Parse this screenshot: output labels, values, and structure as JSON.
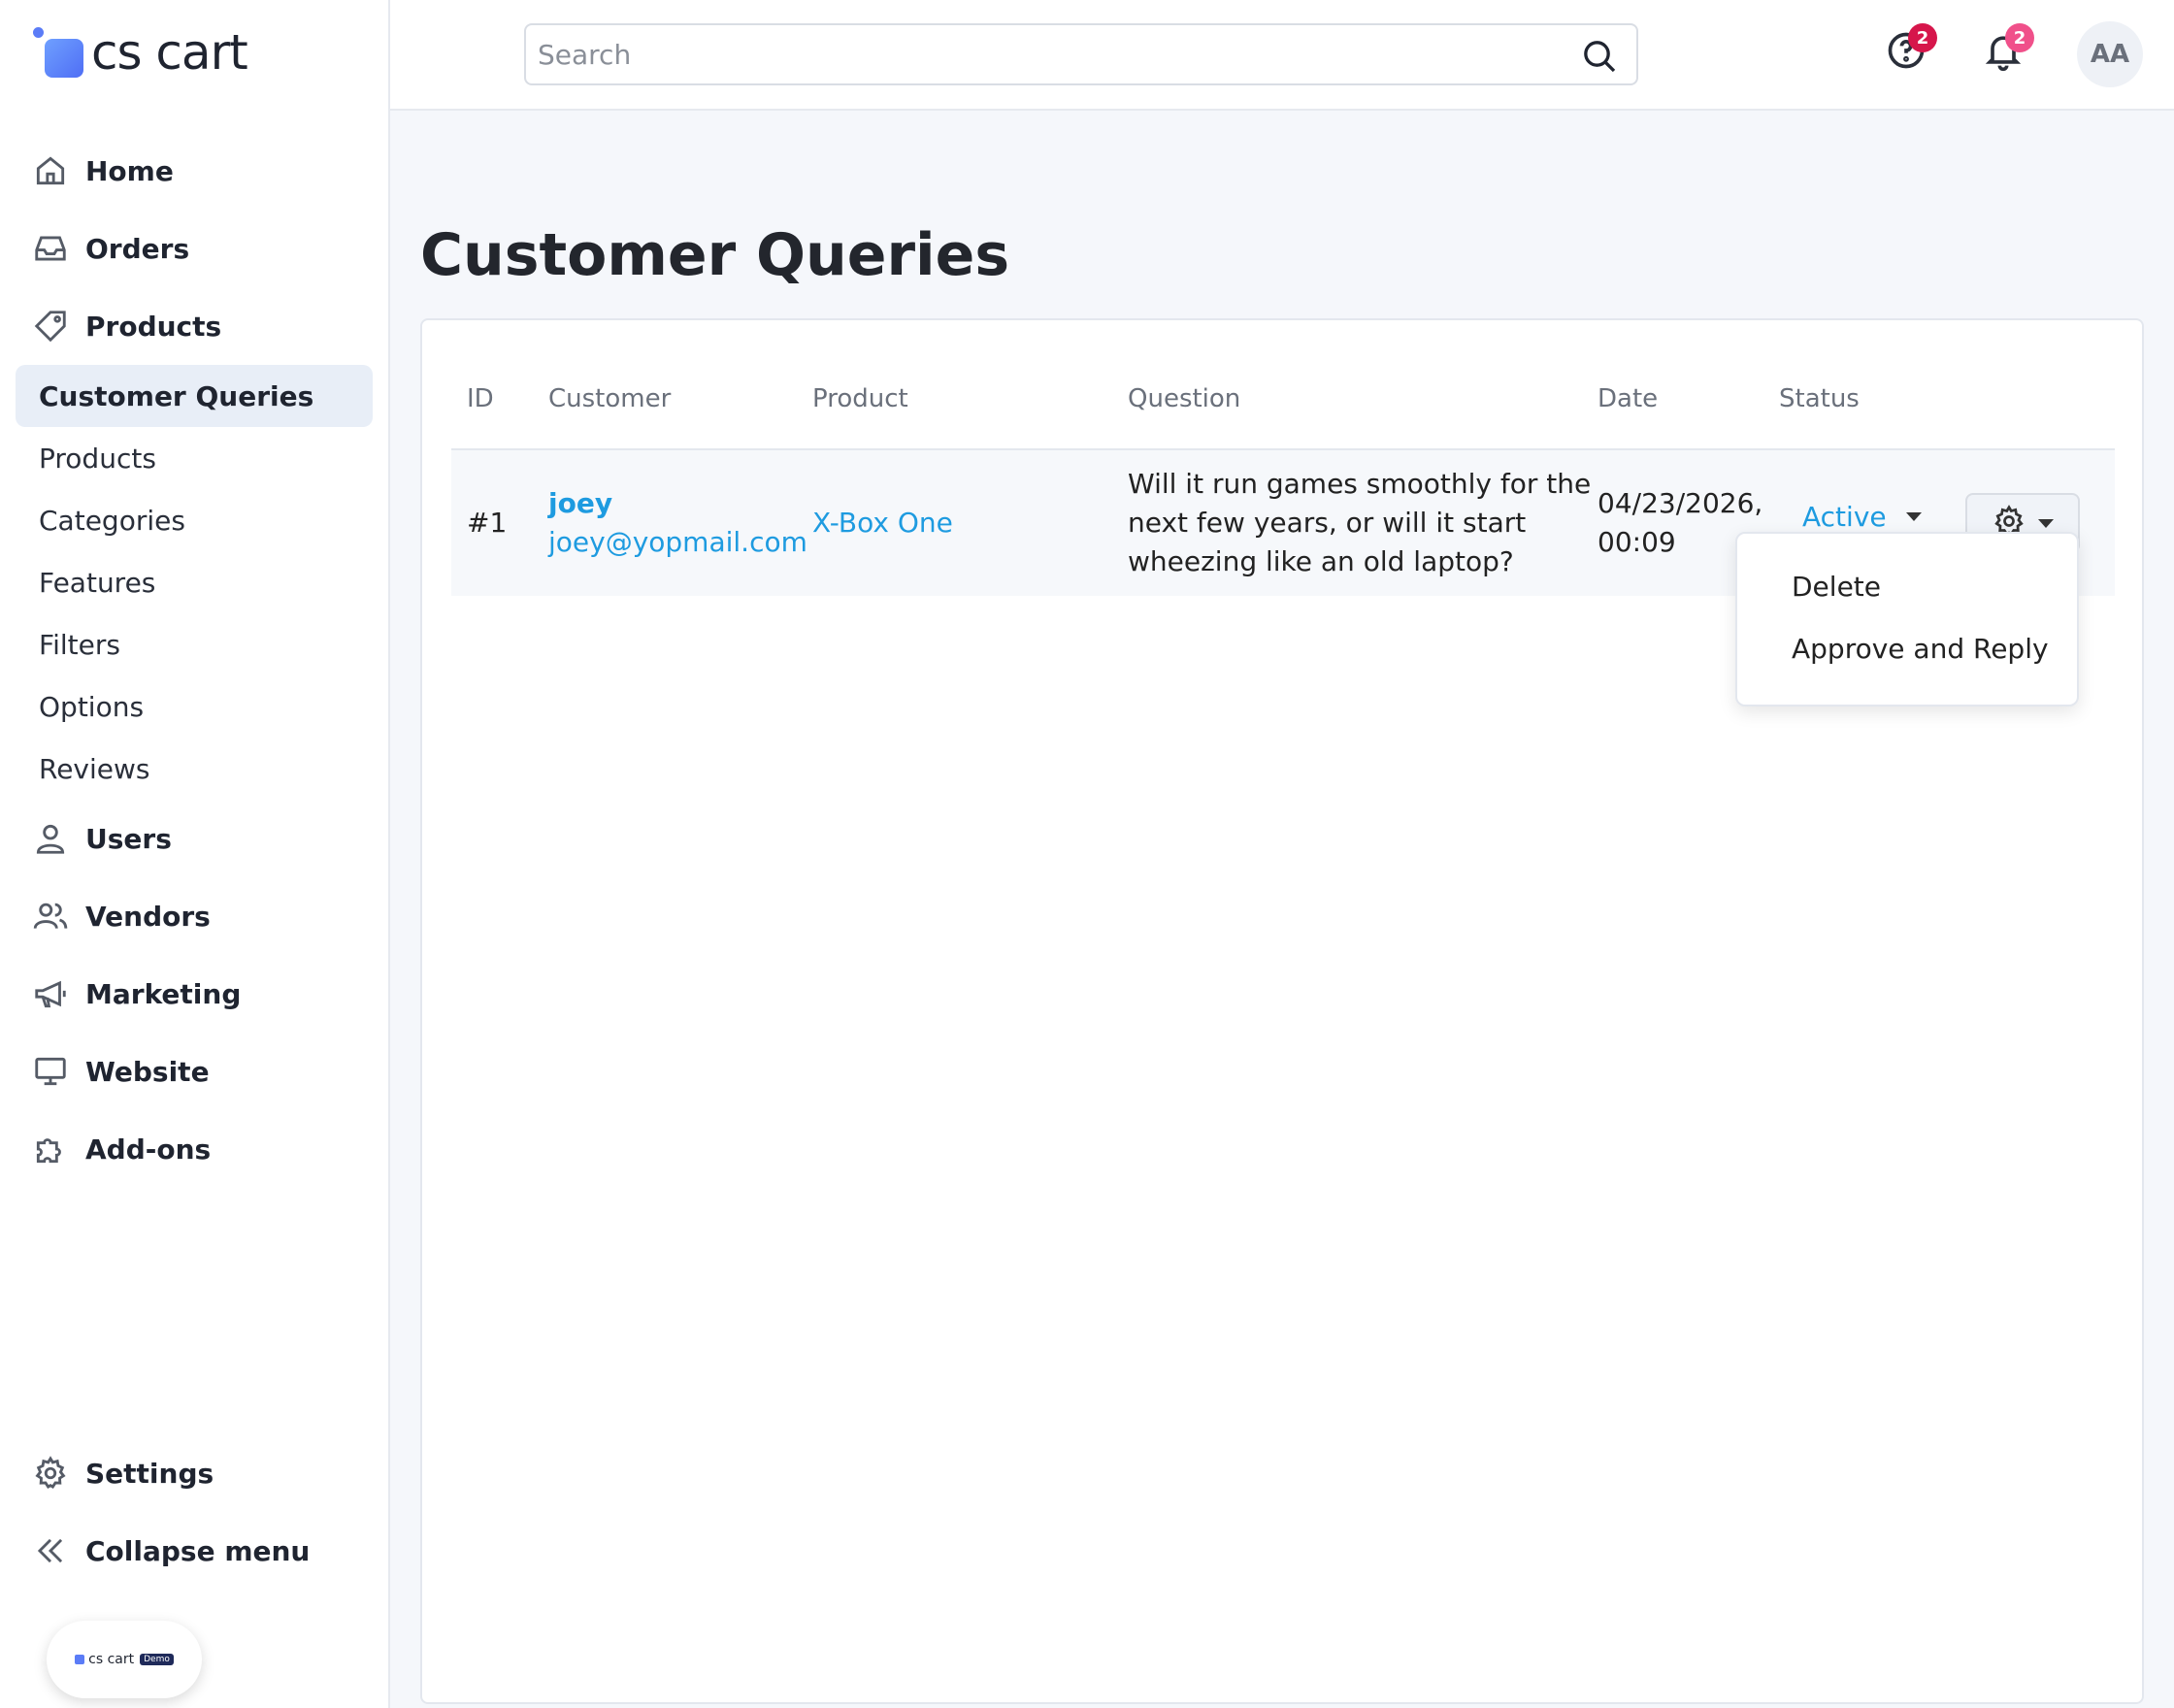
{
  "brand": {
    "name": "cs cart",
    "demo_label": "cs cart",
    "demo_tag": "Demo"
  },
  "sidebar": {
    "items": [
      {
        "label": "Home",
        "icon": "home-icon"
      },
      {
        "label": "Orders",
        "icon": "inbox-icon"
      },
      {
        "label": "Products",
        "icon": "tag-icon"
      }
    ],
    "products_sub": [
      {
        "label": "Customer Queries",
        "active": true
      },
      {
        "label": "Products"
      },
      {
        "label": "Categories"
      },
      {
        "label": "Features"
      },
      {
        "label": "Filters"
      },
      {
        "label": "Options"
      },
      {
        "label": "Reviews"
      }
    ],
    "items_after": [
      {
        "label": "Users",
        "icon": "user-icon"
      },
      {
        "label": "Vendors",
        "icon": "users-icon"
      },
      {
        "label": "Marketing",
        "icon": "megaphone-icon"
      },
      {
        "label": "Website",
        "icon": "monitor-icon"
      },
      {
        "label": "Add-ons",
        "icon": "puzzle-icon"
      }
    ],
    "bottom": [
      {
        "label": "Settings",
        "icon": "gear-icon"
      },
      {
        "label": "Collapse menu",
        "icon": "double-chevron-left-icon"
      }
    ]
  },
  "header": {
    "search_placeholder": "Search",
    "help_badge": "2",
    "notifications_badge": "2",
    "avatar_initials": "AA",
    "help_badge_color": "#d6164b",
    "notif_badge_color": "#f0508a"
  },
  "page": {
    "title": "Customer Queries"
  },
  "table": {
    "columns": [
      "ID",
      "Customer",
      "Product",
      "Question",
      "Date",
      "Status"
    ],
    "rows": [
      {
        "id": "#1",
        "customer_name": "joey",
        "customer_email": "joey@yopmail.com",
        "product": "X-Box One",
        "question_lines": [
          "Will it run games smoothly for the",
          "next few years, or will it start",
          "wheezing like an old laptop?"
        ],
        "date_lines": [
          "04/23/2026,",
          "00:09"
        ],
        "status": "Active"
      }
    ]
  },
  "actions_menu": {
    "items": [
      "Delete",
      "Approve and Reply"
    ]
  },
  "colors": {
    "link": "#1e9be0",
    "active_nav_bg": "#e8eef7"
  }
}
